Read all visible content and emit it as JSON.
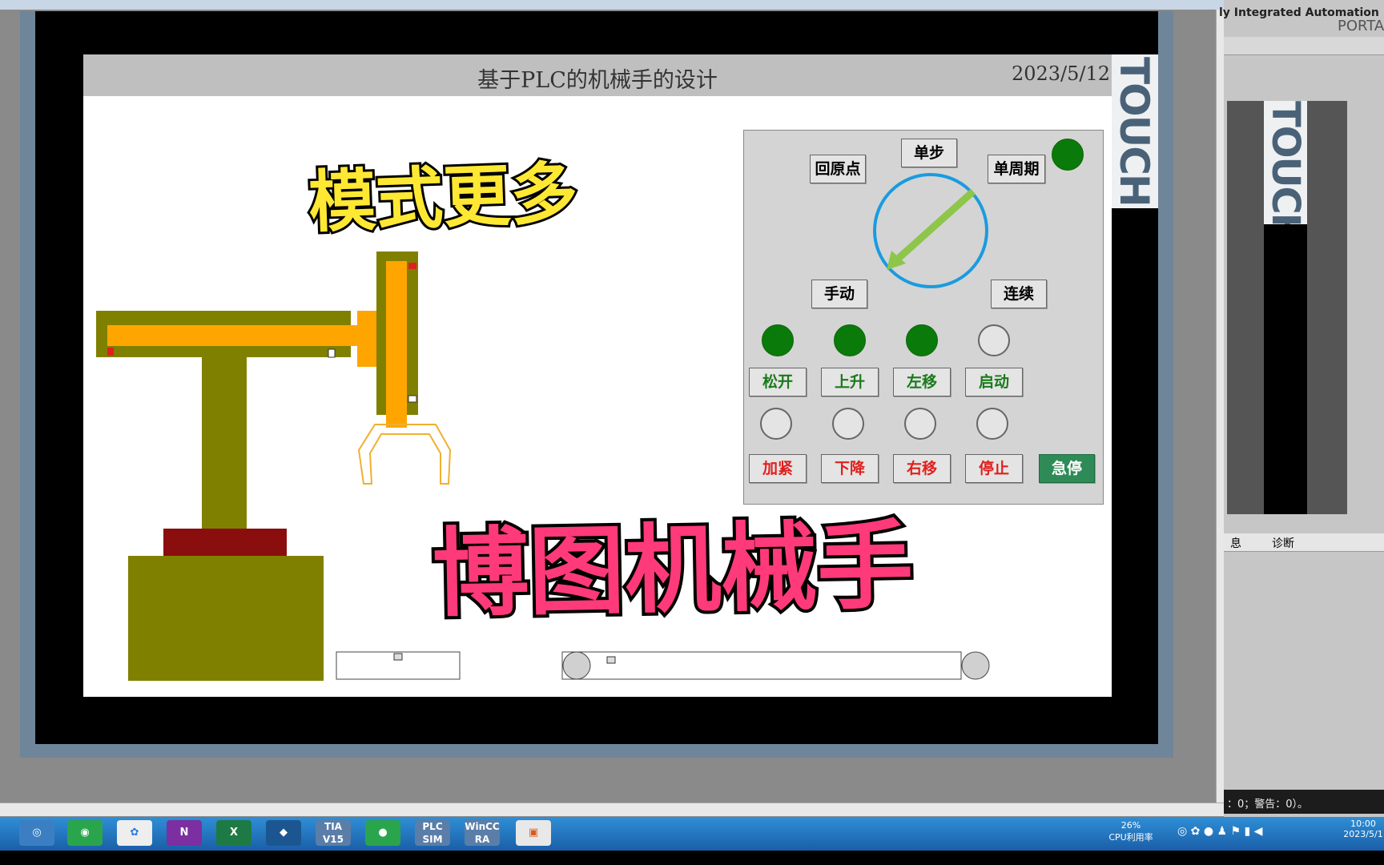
{
  "window": {
    "ide_title": "ly Integrated Automation",
    "ide_brand": "PORTAL"
  },
  "hmi": {
    "title": "基于PLC的机械手的设计",
    "date": "2023/5/12",
    "brand_vertical": "TOUCH",
    "mode_labels": {
      "home": "回原点",
      "single_step": "单步",
      "single_cycle": "单周期",
      "manual": "手动",
      "continuous": "连续"
    },
    "buttons_row1": [
      "松开",
      "上升",
      "左移",
      "启动"
    ],
    "buttons_row2": [
      "加紧",
      "下降",
      "右移",
      "停止"
    ],
    "estop_label": "急停",
    "lamps_row1": [
      "on",
      "on",
      "on",
      "off"
    ],
    "lamps_row2": [
      "off",
      "off",
      "off",
      "off"
    ],
    "mode_indicator": "on",
    "colors": {
      "lamp_on": "#0a7a0a",
      "row1_text": "#1a7a1a",
      "row2_text": "#e0201e",
      "estop": "#2e8b57",
      "arm": "#808000",
      "slider": "#ffa500",
      "base_top": "#8b0e0e"
    }
  },
  "overlay": {
    "caption_top": "模式更多",
    "caption_bottom": "博图机械手"
  },
  "side_panel": {
    "tab_info": "息",
    "tab_diag": "诊断",
    "status": "：0；警告：0）。"
  },
  "taskbar": {
    "apps": [
      "TIA V15",
      "PLC SIM",
      "WinCC RA"
    ],
    "cpu_label": "CPU利用率",
    "cpu_value": "26%",
    "clock_time": "10:00",
    "clock_date": "2023/5/1"
  }
}
